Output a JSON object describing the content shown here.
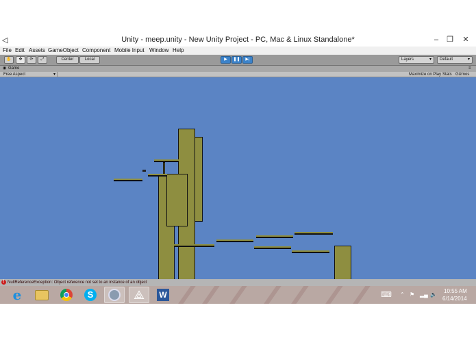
{
  "window": {
    "title": "Unity - meep.unity - New Unity Project - PC, Mac & Linux Standalone*",
    "minimize_glyph": "–",
    "maximize_glyph": "❐",
    "close_glyph": "✕"
  },
  "menu": {
    "items": [
      "File",
      "Edit",
      "Assets",
      "GameObject",
      "Component",
      "Mobile Input",
      "Window",
      "Help"
    ]
  },
  "toolbar": {
    "tools": [
      "hand-tool",
      "move-tool",
      "rotate-tool",
      "scale-tool"
    ],
    "pivot_label": "Center",
    "space_label": "Local",
    "layers_label": "Layers",
    "layout_label": "Default",
    "play_glyph": "▶",
    "pause_glyph": "❚❚",
    "step_glyph": "▶|"
  },
  "game_panel": {
    "tab_label": "Game",
    "aspect_label": "Free Aspect",
    "maximize_label": "Maximize on Play",
    "stats_label": "Stats",
    "gizmos_label": "Gizmos"
  },
  "status": {
    "error_text": "NullReferenceException: Object reference not set to an instance of an object"
  },
  "taskbar": {
    "apps": [
      "internet-explorer",
      "file-explorer",
      "chrome",
      "skype",
      "app-5",
      "unity",
      "word"
    ],
    "time": "10:55 AM",
    "date": "6/14/2014"
  },
  "colors": {
    "sky": "#5b84c4",
    "platform": "#8e8e40",
    "error": "#cc1f1f",
    "play_active": "#3b82c9"
  }
}
